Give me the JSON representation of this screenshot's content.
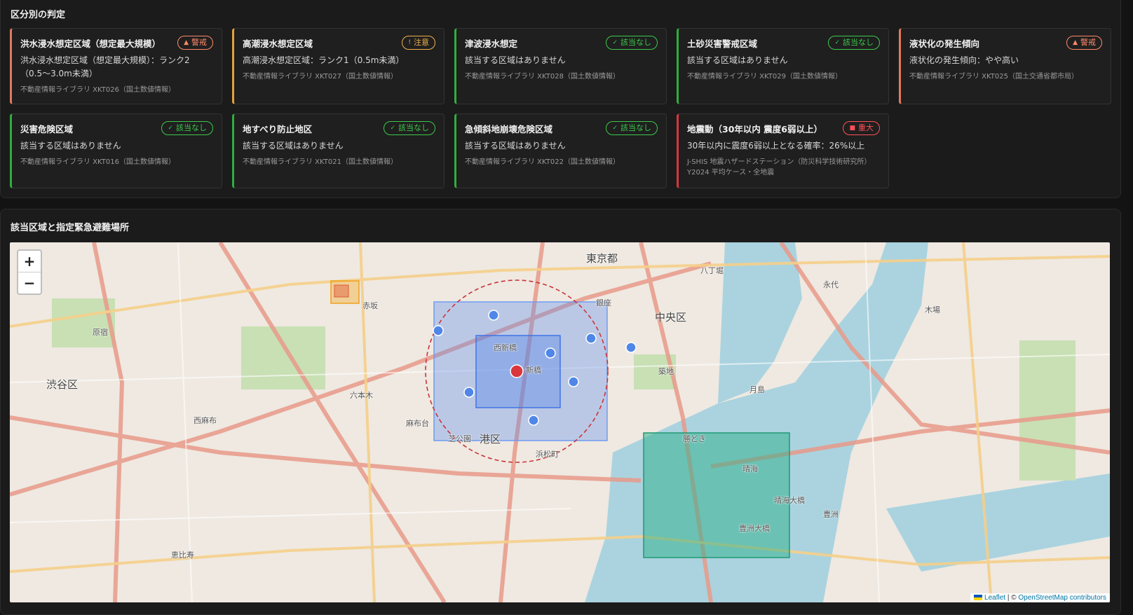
{
  "sections": {
    "judgement_title": "区分別の判定",
    "map_title": "該当区域と指定緊急避難場所"
  },
  "colors": {
    "warning": "#ff8a6a",
    "caution": "#f0b24c",
    "none": "#3cc94b",
    "severe": "#ff5057",
    "area_blue": "#5b8def",
    "area_green": "#2bb08a",
    "center_red": "#d9363e"
  },
  "cards": [
    {
      "title": "洪水浸水想定区域（想定最大規模）",
      "badge": "警戒",
      "badge_icon": "triangle-icon",
      "severity": "warning",
      "body": "洪水浸水想定区域（想定最大規模）：ランク2（0.5〜3.0m未満）",
      "source": "不動産情報ライブラリ XKT026（国土数値情報）"
    },
    {
      "title": "高潮浸水想定区域",
      "badge": "注意",
      "badge_icon": "exclamation-icon",
      "severity": "caution",
      "body": "高潮浸水想定区域：ランク1（0.5m未満）",
      "source": "不動産情報ライブラリ XKT027（国土数値情報）"
    },
    {
      "title": "津波浸水想定",
      "badge": "該当なし",
      "badge_icon": "check-icon",
      "severity": "none",
      "body": "該当する区域はありません",
      "source": "不動産情報ライブラリ XKT028（国土数値情報）"
    },
    {
      "title": "土砂災害警戒区域",
      "badge": "該当なし",
      "badge_icon": "check-icon",
      "severity": "none",
      "body": "該当する区域はありません",
      "source": "不動産情報ライブラリ XKT029（国土数値情報）"
    },
    {
      "title": "液状化の発生傾向",
      "badge": "警戒",
      "badge_icon": "triangle-icon",
      "severity": "warning",
      "body": "液状化の発生傾向：やや高い",
      "source": "不動産情報ライブラリ XKT025（国土交通省都市局）"
    },
    {
      "title": "災害危険区域",
      "badge": "該当なし",
      "badge_icon": "check-icon",
      "severity": "none",
      "body": "該当する区域はありません",
      "source": "不動産情報ライブラリ XKT016（国土数値情報）"
    },
    {
      "title": "地すべり防止地区",
      "badge": "該当なし",
      "badge_icon": "check-icon",
      "severity": "none",
      "body": "該当する区域はありません",
      "source": "不動産情報ライブラリ XKT021（国土数値情報）"
    },
    {
      "title": "急傾斜地崩壊危険区域",
      "badge": "該当なし",
      "badge_icon": "check-icon",
      "severity": "none",
      "body": "該当する区域はありません",
      "source": "不動産情報ライブラリ XKT022（国土数値情報）"
    },
    {
      "title": "地震動（30年以内 震度6弱以上）",
      "badge": "重大",
      "badge_icon": "square-icon",
      "severity": "severe",
      "body": "30年以内に震度6弱以上となる確率：26%以上",
      "source": "J-SHIS 地震ハザードステーション（防災科学技術研究所）Y2024 平均ケース・全地震"
    }
  ],
  "map": {
    "zoom_in": "+",
    "zoom_out": "−",
    "attribution_link": "Leaflet",
    "attribution_sep": " | © ",
    "attribution_text": "OpenStreetMap contributors",
    "labels": {
      "tokyo": "東京都",
      "chuo": "中央区",
      "minato": "港区",
      "shibuya": "渋谷区",
      "shinbashi": "新橋",
      "nishishinbashi": "西新橋",
      "harumi": "晴海",
      "toyosu": "豊洲",
      "tsukiji": "築地",
      "ginza": "銀座",
      "akasaka": "赤坂",
      "roppongi": "六本木",
      "azabudai": "麻布台",
      "hamamatsucho": "浜松町",
      "harumi_ohashi": "晴海大橋",
      "toyosu_ohashi": "豊洲大橋",
      "kachidoki": "勝どき",
      "tsukishima": "月島",
      "hatchobori": "八丁堀",
      "eitai": "永代",
      "kiba": "木場",
      "shiba_park": "芝公園",
      "ebisu": "恵比寿",
      "harajuku": "原宿",
      "nishiazabu": "西麻布"
    }
  }
}
